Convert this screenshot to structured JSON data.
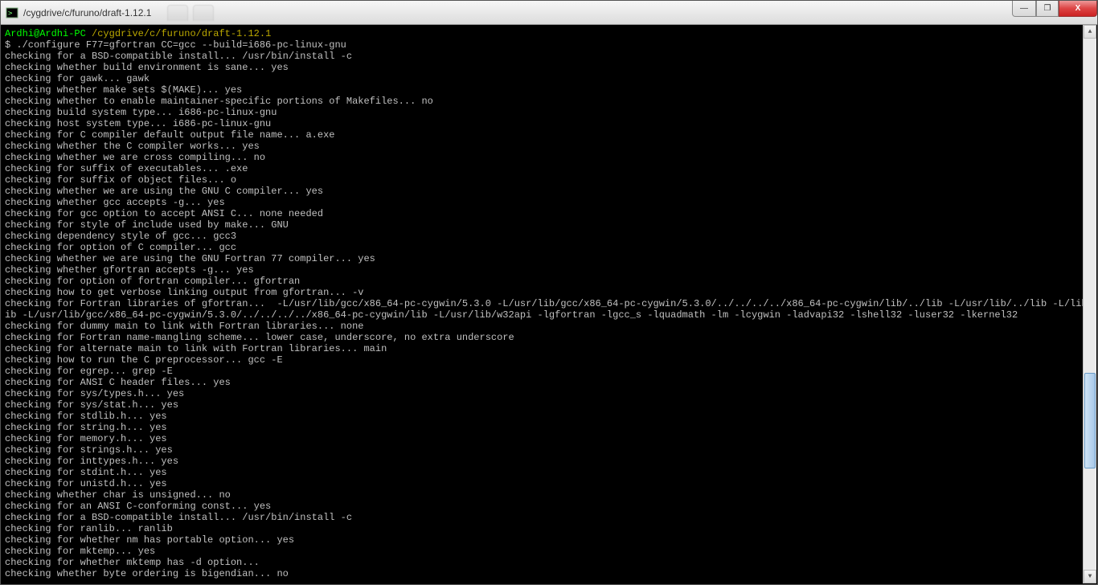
{
  "window": {
    "title": "/cygdrive/c/furuno/draft-1.12.1",
    "tabs_blur": [
      "                      ",
      "          "
    ],
    "btn_min": "—",
    "btn_max": "❐",
    "btn_close": "X"
  },
  "prompt": {
    "user": "Ardhi@Ardhi-PC",
    "path": "/cygdrive/c/furuno/draft-1.12.1",
    "symbol": "$",
    "command": "./configure F77=gfortran CC=gcc --build=i686-pc-linux-gnu"
  },
  "lines": [
    "checking for a BSD-compatible install... /usr/bin/install -c",
    "checking whether build environment is sane... yes",
    "checking for gawk... gawk",
    "checking whether make sets $(MAKE)... yes",
    "checking whether to enable maintainer-specific portions of Makefiles... no",
    "checking build system type... i686-pc-linux-gnu",
    "checking host system type... i686-pc-linux-gnu",
    "checking for C compiler default output file name... a.exe",
    "checking whether the C compiler works... yes",
    "checking whether we are cross compiling... no",
    "checking for suffix of executables... .exe",
    "checking for suffix of object files... o",
    "checking whether we are using the GNU C compiler... yes",
    "checking whether gcc accepts -g... yes",
    "checking for gcc option to accept ANSI C... none needed",
    "checking for style of include used by make... GNU",
    "checking dependency style of gcc... gcc3",
    "checking for option of C compiler... gcc",
    "checking whether we are using the GNU Fortran 77 compiler... yes",
    "checking whether gfortran accepts -g... yes",
    "checking for option of fortran compiler... gfortran",
    "checking how to get verbose linking output from gfortran... -v",
    "checking for Fortran libraries of gfortran...  -L/usr/lib/gcc/x86_64-pc-cygwin/5.3.0 -L/usr/lib/gcc/x86_64-pc-cygwin/5.3.0/../../../../x86_64-pc-cygwin/lib/../lib -L/usr/lib/../lib -L/lib/../l",
    "ib -L/usr/lib/gcc/x86_64-pc-cygwin/5.3.0/../../../../x86_64-pc-cygwin/lib -L/usr/lib/w32api -lgfortran -lgcc_s -lquadmath -lm -lcygwin -ladvapi32 -lshell32 -luser32 -lkernel32",
    "checking for dummy main to link with Fortran libraries... none",
    "checking for Fortran name-mangling scheme... lower case, underscore, no extra underscore",
    "checking for alternate main to link with Fortran libraries... main",
    "checking how to run the C preprocessor... gcc -E",
    "checking for egrep... grep -E",
    "checking for ANSI C header files... yes",
    "checking for sys/types.h... yes",
    "checking for sys/stat.h... yes",
    "checking for stdlib.h... yes",
    "checking for string.h... yes",
    "checking for memory.h... yes",
    "checking for strings.h... yes",
    "checking for inttypes.h... yes",
    "checking for stdint.h... yes",
    "checking for unistd.h... yes",
    "checking whether char is unsigned... no",
    "checking for an ANSI C-conforming const... yes",
    "checking for a BSD-compatible install... /usr/bin/install -c",
    "checking for ranlib... ranlib",
    "checking for whether nm has portable option... yes",
    "checking for mktemp... yes",
    "checking for whether mktemp has -d option...",
    "checking whether byte ordering is bigendian... no"
  ]
}
